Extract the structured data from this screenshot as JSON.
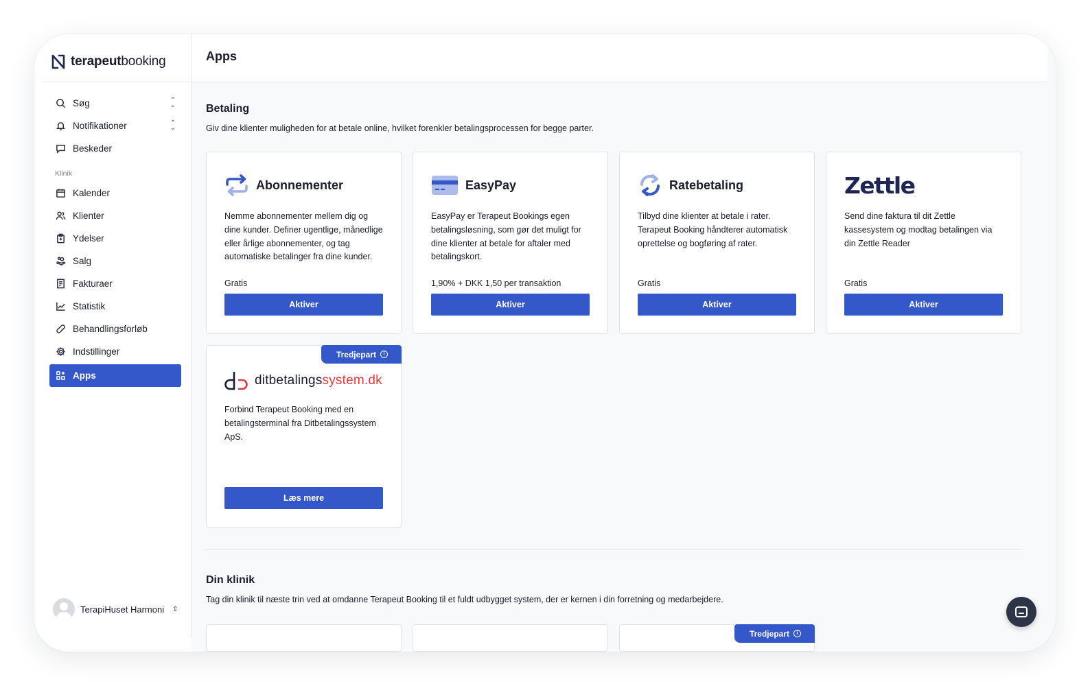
{
  "brand": {
    "name_bold": "terapeut",
    "name_light": "booking"
  },
  "sidebar": {
    "top_items": [
      {
        "label": "Søg",
        "icon": "search-icon",
        "has_chevron": true
      },
      {
        "label": "Notifikationer",
        "icon": "bell-icon",
        "has_chevron": true
      },
      {
        "label": "Beskeder",
        "icon": "message-icon",
        "has_chevron": false
      }
    ],
    "section_label": "Klinik",
    "items": [
      {
        "label": "Kalender",
        "icon": "calendar-icon"
      },
      {
        "label": "Klienter",
        "icon": "users-icon"
      },
      {
        "label": "Ydelser",
        "icon": "clipboard-icon"
      },
      {
        "label": "Salg",
        "icon": "hand-coins-icon"
      },
      {
        "label": "Fakturaer",
        "icon": "invoice-icon"
      },
      {
        "label": "Statistik",
        "icon": "chart-icon"
      },
      {
        "label": "Behandlingsforløb",
        "icon": "bandage-icon"
      },
      {
        "label": "Indstillinger",
        "icon": "gear-icon"
      },
      {
        "label": "Apps",
        "icon": "apps-icon",
        "active": true
      }
    ],
    "profile": {
      "name": "TerapiHuset Harmoni"
    }
  },
  "header": {
    "title": "Apps"
  },
  "payment": {
    "title": "Betaling",
    "description": "Giv dine klienter muligheden for at betale online, hvilket forenkler betalingsprocessen for begge parter.",
    "cards": [
      {
        "name": "Abonnementer",
        "icon": "repeat-arrows-icon",
        "description": "Nemme abonnementer mellem dig og dine kunder. Definer ugentlige, månedlige eller årlige abonnementer, og tag automatiske betalinger fra dine kunder.",
        "price": "Gratis",
        "button": "Aktiver"
      },
      {
        "name": "EasyPay",
        "icon": "credit-card-icon",
        "description": "EasyPay er Terapeut Bookings egen betalingsløsning, som gør det muligt for dine klienter at betale for aftaler med betalingskort.",
        "price": "1,90% + DKK 1,50 per transaktion",
        "button": "Aktiver"
      },
      {
        "name": "Ratebetaling",
        "icon": "refresh-icon",
        "description": "Tilbyd dine klienter at betale i rater. Terapeut Booking håndterer automatisk oprettelse og bogføring af rater.",
        "price": "Gratis",
        "button": "Aktiver"
      },
      {
        "name": "Zettle",
        "icon": "zettle-logo",
        "description": "Send dine faktura til dit Zettle kassesystem og modtag betalingen via din Zettle Reader",
        "price": "Gratis",
        "button": "Aktiver"
      }
    ],
    "third_party_card": {
      "badge": "Tredjepart",
      "logo_dark": "ditbetalings",
      "logo_red": "system.dk",
      "description": "Forbind Terapeut Booking med en betalingsterminal fra Ditbetalingssystem ApS.",
      "button": "Læs mere"
    }
  },
  "clinic": {
    "title": "Din klinik",
    "description": "Tag din klinik til næste trin ved at omdanne Terapeut Booking til et fuldt udbygget system, der er kernen i din forretning og medarbejdere.",
    "peek_badge": "Tredjepart"
  },
  "colors": {
    "accent": "#3457c9",
    "brand_dark": "#1f2654",
    "red": "#e33a3a"
  }
}
